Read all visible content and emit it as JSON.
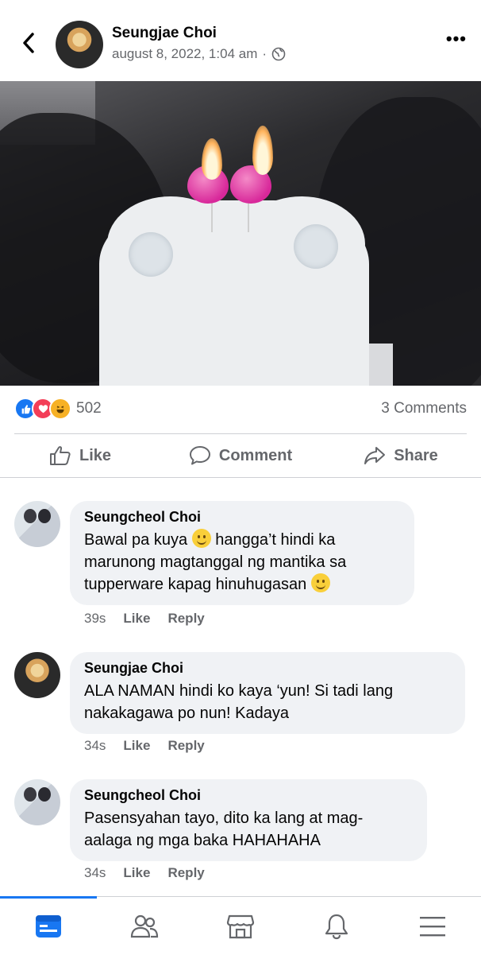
{
  "post": {
    "author": "Seungjae Choi",
    "timestamp": "august 8, 2022, 1:04 am",
    "separator": "·",
    "reaction_count": "502",
    "comments_count": "3 Comments"
  },
  "actions": {
    "like": "Like",
    "comment": "Comment",
    "share": "Share"
  },
  "comments": [
    {
      "name": "Seungcheol Choi",
      "lines": [
        "Bawal pa kuya",
        "hangga’t hindi ka",
        "marunong magtanggal ng mantika sa",
        "tupperware kapag hinuhugasan"
      ],
      "time": "39s",
      "like": "Like",
      "reply": "Reply"
    },
    {
      "name": "Seungjae Choi",
      "lines": [
        "ALA NAMAN hindi ko kaya ‘yun! Si tadi lang",
        "nakakagawa po nun! Kadaya"
      ],
      "time": "34s",
      "like": "Like",
      "reply": "Reply"
    },
    {
      "name": "Seungcheol Choi",
      "lines": [
        "Pasensyahan tayo, dito ka lang at mag-",
        "aalaga ng mga baka HAHAHAHA"
      ],
      "time": "34s",
      "like": "Like",
      "reply": "Reply"
    }
  ],
  "icons": {
    "back": "chevron-left-icon",
    "more": "more-icon",
    "audience": "globe-icon",
    "nav": [
      "feed-icon",
      "friends-icon",
      "marketplace-icon",
      "notifications-icon",
      "menu-icon"
    ]
  },
  "colors": {
    "brand": "#1877f2",
    "like_reaction": "#1877f2",
    "love_reaction": "#f33e58",
    "haha_reaction": "#f7b125",
    "muted_text": "#65676b",
    "bubble_bg": "#f0f2f5"
  }
}
